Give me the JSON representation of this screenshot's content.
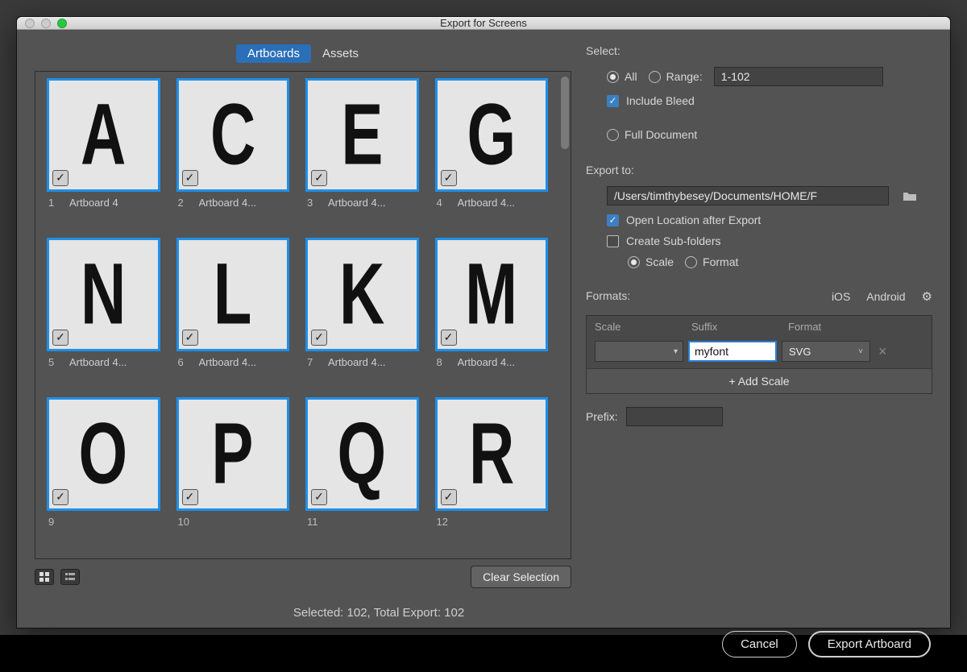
{
  "window": {
    "title": "Export for Screens"
  },
  "tabs": {
    "artboards": "Artboards",
    "assets": "Assets",
    "active": "artboards"
  },
  "artboards": [
    {
      "idx": "1",
      "name": "Artboard 4",
      "glyph": "A",
      "checked": true
    },
    {
      "idx": "2",
      "name": "Artboard 4...",
      "glyph": "C",
      "checked": true
    },
    {
      "idx": "3",
      "name": "Artboard 4...",
      "glyph": "E",
      "checked": true
    },
    {
      "idx": "4",
      "name": "Artboard 4...",
      "glyph": "G",
      "checked": true
    },
    {
      "idx": "5",
      "name": "Artboard 4...",
      "glyph": "N",
      "checked": true
    },
    {
      "idx": "6",
      "name": "Artboard 4...",
      "glyph": "L",
      "checked": true
    },
    {
      "idx": "7",
      "name": "Artboard 4...",
      "glyph": "K",
      "checked": true
    },
    {
      "idx": "8",
      "name": "Artboard 4...",
      "glyph": "M",
      "checked": true
    },
    {
      "idx": "9",
      "name": "",
      "glyph": "O",
      "checked": true
    },
    {
      "idx": "10",
      "name": "",
      "glyph": "P",
      "checked": true
    },
    {
      "idx": "11",
      "name": "",
      "glyph": "Q",
      "checked": true
    },
    {
      "idx": "12",
      "name": "",
      "glyph": "R",
      "checked": true
    }
  ],
  "clear_selection": "Clear Selection",
  "select": {
    "label": "Select:",
    "all": "All",
    "range": "Range:",
    "range_value": "1-102",
    "include_bleed": "Include Bleed",
    "full_document": "Full Document"
  },
  "export_to": {
    "label": "Export to:",
    "path": "/Users/timthybesey/Documents/HOME/F",
    "open_after": "Open Location after Export",
    "create_subfolders": "Create Sub-folders",
    "scale": "Scale",
    "format": "Format"
  },
  "formats": {
    "label": "Formats:",
    "ios": "iOS",
    "android": "Android",
    "col_scale": "Scale",
    "col_suffix": "Suffix",
    "col_format": "Format",
    "rows": [
      {
        "scale": "",
        "suffix": "myfont",
        "format": "SVG"
      }
    ],
    "add_scale": "+ Add Scale"
  },
  "prefix": {
    "label": "Prefix:",
    "value": ""
  },
  "status": "Selected: 102, Total Export: 102",
  "buttons": {
    "cancel": "Cancel",
    "export": "Export Artboard"
  }
}
